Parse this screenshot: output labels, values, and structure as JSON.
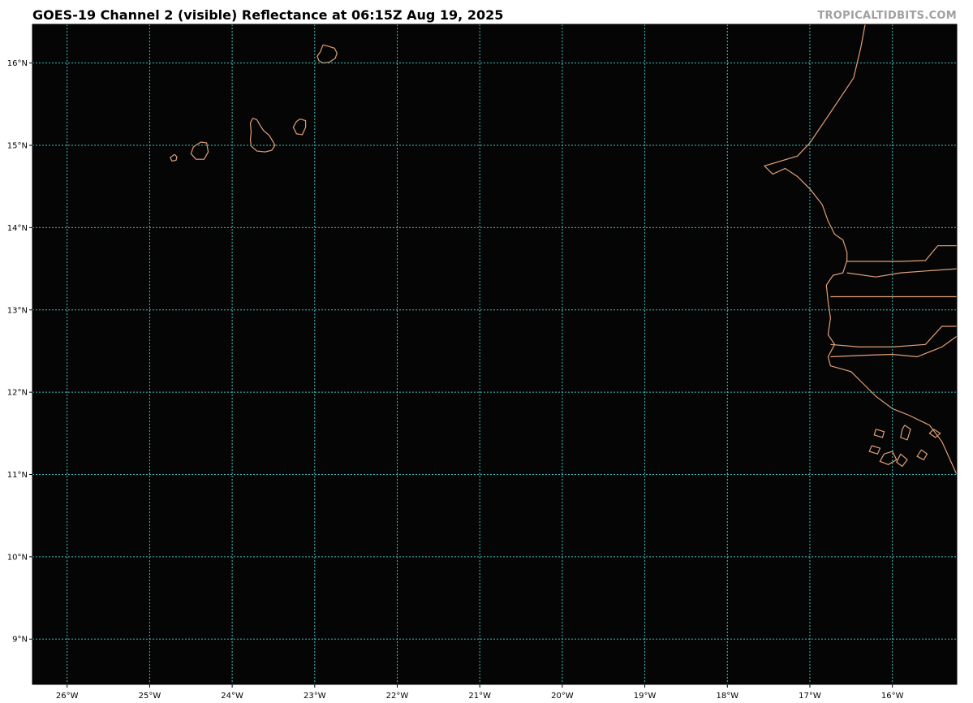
{
  "title": "GOES-19 Channel 2 (visible) Reflectance at 06:15Z Aug 19, 2025",
  "credit": "TROPICALTIDBITS.COM",
  "map": {
    "projection": "equirectangular",
    "lon_range": [
      -26.42,
      -15.22
    ],
    "lat_range": [
      8.45,
      16.47
    ],
    "background_color": "#050505",
    "grid_color": "#40c0c0",
    "coastline_color": "#e0a078",
    "grid_style": "dotted",
    "lon_ticks": [
      {
        "value": -26,
        "label": "26°W"
      },
      {
        "value": -25,
        "label": "25°W"
      },
      {
        "value": -24,
        "label": "24°W"
      },
      {
        "value": -23,
        "label": "23°W"
      },
      {
        "value": -22,
        "label": "22°W"
      },
      {
        "value": -21,
        "label": "21°W"
      },
      {
        "value": -20,
        "label": "20°W"
      },
      {
        "value": -19,
        "label": "19°W"
      },
      {
        "value": -18,
        "label": "18°W"
      },
      {
        "value": -17,
        "label": "17°W"
      },
      {
        "value": -16,
        "label": "16°W"
      }
    ],
    "lat_ticks": [
      {
        "value": 16,
        "label": "16°N"
      },
      {
        "value": 15,
        "label": "15°N"
      },
      {
        "value": 14,
        "label": "14°N"
      },
      {
        "value": 13,
        "label": "13°N"
      },
      {
        "value": 12,
        "label": "12°N"
      },
      {
        "value": 11,
        "label": "11°N"
      },
      {
        "value": 10,
        "label": "10°N"
      },
      {
        "value": 9,
        "label": "9°N"
      }
    ],
    "features": [
      {
        "name": "island-sal-area",
        "coords": [
          [
            -22.9,
            16.22
          ],
          [
            -22.82,
            16.2
          ],
          [
            -22.76,
            16.18
          ],
          [
            -22.73,
            16.12
          ],
          [
            -22.75,
            16.06
          ],
          [
            -22.82,
            16.01
          ],
          [
            -22.9,
            16.0
          ],
          [
            -22.95,
            16.03
          ],
          [
            -22.97,
            16.08
          ],
          [
            -22.93,
            16.14
          ],
          [
            -22.9,
            16.22
          ]
        ]
      },
      {
        "name": "island-santiago",
        "coords": [
          [
            -23.75,
            15.33
          ],
          [
            -23.7,
            15.31
          ],
          [
            -23.66,
            15.24
          ],
          [
            -23.62,
            15.18
          ],
          [
            -23.55,
            15.12
          ],
          [
            -23.48,
            15.0
          ],
          [
            -23.52,
            14.94
          ],
          [
            -23.6,
            14.92
          ],
          [
            -23.7,
            14.93
          ],
          [
            -23.77,
            14.99
          ],
          [
            -23.78,
            15.07
          ],
          [
            -23.77,
            15.16
          ],
          [
            -23.78,
            15.27
          ],
          [
            -23.75,
            15.33
          ]
        ]
      },
      {
        "name": "island-maio",
        "coords": [
          [
            -23.18,
            15.32
          ],
          [
            -23.11,
            15.3
          ],
          [
            -23.11,
            15.22
          ],
          [
            -23.15,
            15.13
          ],
          [
            -23.22,
            15.14
          ],
          [
            -23.26,
            15.22
          ],
          [
            -23.22,
            15.29
          ],
          [
            -23.18,
            15.32
          ]
        ]
      },
      {
        "name": "island-fogo",
        "coords": [
          [
            -24.38,
            15.04
          ],
          [
            -24.31,
            15.03
          ],
          [
            -24.29,
            14.92
          ],
          [
            -24.34,
            14.83
          ],
          [
            -24.44,
            14.83
          ],
          [
            -24.5,
            14.9
          ],
          [
            -24.47,
            14.98
          ],
          [
            -24.38,
            15.04
          ]
        ]
      },
      {
        "name": "island-brava",
        "coords": [
          [
            -24.7,
            14.89
          ],
          [
            -24.67,
            14.86
          ],
          [
            -24.68,
            14.82
          ],
          [
            -24.73,
            14.81
          ],
          [
            -24.75,
            14.85
          ],
          [
            -24.7,
            14.89
          ]
        ]
      },
      {
        "name": "coast-mauritania-senegal",
        "coords": [
          [
            -16.33,
            16.47
          ],
          [
            -16.38,
            16.2
          ],
          [
            -16.47,
            15.82
          ],
          [
            -16.75,
            15.4
          ],
          [
            -17.0,
            15.03
          ],
          [
            -17.15,
            14.87
          ],
          [
            -17.55,
            14.75
          ],
          [
            -17.45,
            14.65
          ],
          [
            -17.3,
            14.72
          ],
          [
            -17.15,
            14.62
          ],
          [
            -17.0,
            14.47
          ],
          [
            -16.85,
            14.28
          ],
          [
            -16.78,
            14.08
          ],
          [
            -16.7,
            13.92
          ],
          [
            -16.6,
            13.85
          ],
          [
            -16.55,
            13.7
          ],
          [
            -16.55,
            13.6
          ],
          [
            -16.6,
            13.45
          ],
          [
            -16.72,
            13.42
          ],
          [
            -16.8,
            13.3
          ],
          [
            -16.78,
            13.1
          ],
          [
            -16.75,
            12.9
          ],
          [
            -16.78,
            12.7
          ],
          [
            -16.7,
            12.58
          ],
          [
            -16.78,
            12.43
          ],
          [
            -16.75,
            12.32
          ],
          [
            -16.5,
            12.25
          ],
          [
            -16.35,
            12.1
          ],
          [
            -16.2,
            11.95
          ],
          [
            -16.0,
            11.8
          ],
          [
            -15.8,
            11.72
          ],
          [
            -15.55,
            11.6
          ],
          [
            -15.4,
            11.4
          ],
          [
            -15.22,
            11.0
          ]
        ]
      },
      {
        "name": "gambia-north-border",
        "coords": [
          [
            -16.55,
            13.59
          ],
          [
            -15.9,
            13.59
          ],
          [
            -15.6,
            13.6
          ],
          [
            -15.45,
            13.78
          ],
          [
            -15.22,
            13.78
          ]
        ]
      },
      {
        "name": "gambia-south-border",
        "coords": [
          [
            -16.75,
            13.16
          ],
          [
            -16.0,
            13.16
          ],
          [
            -15.75,
            13.16
          ],
          [
            -15.22,
            13.16
          ]
        ]
      },
      {
        "name": "gambia-river",
        "coords": [
          [
            -16.55,
            13.45
          ],
          [
            -16.2,
            13.4
          ],
          [
            -15.9,
            13.45
          ],
          [
            -15.5,
            13.48
          ],
          [
            -15.22,
            13.5
          ]
        ]
      },
      {
        "name": "casamance-river",
        "coords": [
          [
            -16.75,
            12.58
          ],
          [
            -16.4,
            12.55
          ],
          [
            -16.0,
            12.55
          ],
          [
            -15.6,
            12.58
          ],
          [
            -15.4,
            12.8
          ],
          [
            -15.22,
            12.8
          ]
        ]
      },
      {
        "name": "guinea-bissau-border",
        "coords": [
          [
            -16.75,
            12.43
          ],
          [
            -16.3,
            12.45
          ],
          [
            -16.0,
            12.46
          ],
          [
            -15.7,
            12.43
          ],
          [
            -15.4,
            12.55
          ],
          [
            -15.22,
            12.68
          ]
        ]
      },
      {
        "name": "bissagos-a",
        "coords": [
          [
            -16.1,
            11.25
          ],
          [
            -16.0,
            11.28
          ],
          [
            -15.95,
            11.18
          ],
          [
            -16.05,
            11.12
          ],
          [
            -16.15,
            11.16
          ],
          [
            -16.1,
            11.25
          ]
        ]
      },
      {
        "name": "bissagos-b",
        "coords": [
          [
            -15.85,
            11.6
          ],
          [
            -15.78,
            11.55
          ],
          [
            -15.82,
            11.42
          ],
          [
            -15.9,
            11.45
          ],
          [
            -15.88,
            11.55
          ],
          [
            -15.85,
            11.6
          ]
        ]
      },
      {
        "name": "bissagos-c",
        "coords": [
          [
            -16.2,
            11.55
          ],
          [
            -16.1,
            11.52
          ],
          [
            -16.12,
            11.45
          ],
          [
            -16.22,
            11.48
          ],
          [
            -16.2,
            11.55
          ]
        ]
      },
      {
        "name": "bissagos-d",
        "coords": [
          [
            -15.65,
            11.3
          ],
          [
            -15.58,
            11.25
          ],
          [
            -15.62,
            11.18
          ],
          [
            -15.7,
            11.22
          ],
          [
            -15.65,
            11.3
          ]
        ]
      },
      {
        "name": "bissagos-e",
        "coords": [
          [
            -16.25,
            11.35
          ],
          [
            -16.15,
            11.32
          ],
          [
            -16.18,
            11.25
          ],
          [
            -16.28,
            11.28
          ],
          [
            -16.25,
            11.35
          ]
        ]
      },
      {
        "name": "bissagos-f",
        "coords": [
          [
            -15.5,
            11.55
          ],
          [
            -15.42,
            11.5
          ],
          [
            -15.48,
            11.45
          ],
          [
            -15.55,
            11.5
          ],
          [
            -15.5,
            11.55
          ]
        ]
      },
      {
        "name": "bissagos-g",
        "coords": [
          [
            -15.9,
            11.25
          ],
          [
            -15.82,
            11.18
          ],
          [
            -15.88,
            11.1
          ],
          [
            -15.95,
            11.15
          ],
          [
            -15.9,
            11.25
          ]
        ]
      }
    ]
  }
}
